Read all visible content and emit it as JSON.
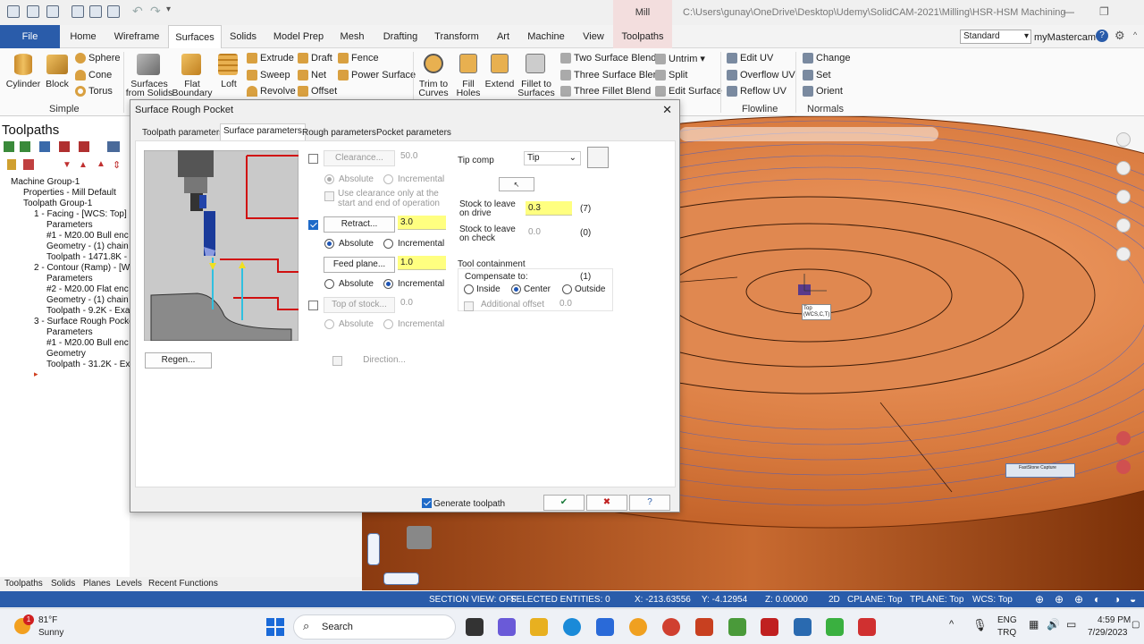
{
  "title_bar": {
    "context_tab": "Mill",
    "path": "C:\\Users\\gunay\\OneDrive\\Desktop\\Udemy\\SolidCAM-2021\\Milling\\HSR-HSM Machining User Gui..."
  },
  "tabs": [
    "File",
    "Home",
    "Wireframe",
    "Surfaces",
    "Solids",
    "Model Prep",
    "Mesh",
    "Drafting",
    "Transform",
    "Art",
    "Machine",
    "View",
    "Toolpaths"
  ],
  "workspace": {
    "standard": "Standard",
    "my": "myMastercam"
  },
  "ribbon": {
    "simple": {
      "label": "Simple",
      "cylinder": "Cylinder",
      "block": "Block",
      "sphere": "Sphere",
      "cone": "Cone",
      "torus": "Torus"
    },
    "create": {
      "surfaces_from_solids": [
        "Surfaces",
        "from Solids"
      ],
      "flat_boundary": [
        "Flat",
        "Boundary"
      ],
      "loft": "Loft",
      "extrude": "Extrude",
      "sweep": "Sweep",
      "revolve": "Revolve",
      "draft": "Draft",
      "net": "Net",
      "offset": "Offset",
      "fence": "Fence",
      "power_surface": "Power Surface"
    },
    "modify": {
      "trim_to_curves": [
        "Trim to",
        "Curves"
      ],
      "fill_holes": [
        "Fill",
        "Holes"
      ],
      "extend": "Extend",
      "fillet_to_surfaces": [
        "Fillet to",
        "Surfaces"
      ],
      "two_surface_blend": "Two Surface Blend",
      "three_surface_blend": "Three Surface Blend",
      "three_fillet_blend": "Three Fillet Blend",
      "untrim": "Untrim",
      "split": "Split",
      "edit_surface": "Edit Surface"
    },
    "flowline": {
      "label": "Flowline",
      "edit_uv": "Edit UV",
      "overflow_uv": "Overflow UV",
      "reflow_uv": "Reflow UV"
    },
    "normals": {
      "label": "Normals",
      "change": "Change",
      "set": "Set",
      "orient": "Orient"
    }
  },
  "toolpaths_panel": {
    "title": "Toolpaths",
    "tree": [
      "Machine Group-1",
      "Properties - Mill Default",
      "Toolpath Group-1",
      "1 - Facing - [WCS: Top]",
      "Parameters",
      "#1 - M20.00 Bull enc",
      "Geometry - (1) chain",
      "Toolpath - 1471.8K -",
      "2 - Contour (Ramp) - [W",
      "Parameters",
      "#2 - M20.00 Flat enc",
      "Geometry - (1) chain",
      "Toolpath - 9.2K - Exa",
      "3 - Surface Rough Pocke",
      "Parameters",
      "#1 - M20.00 Bull enc",
      "Geometry",
      "Toolpath - 31.2K - Ex"
    ],
    "bottom_tabs": [
      "Toolpaths",
      "Solids",
      "Planes",
      "Levels",
      "Recent Functions"
    ]
  },
  "dialog": {
    "title": "Surface Rough Pocket",
    "tabs": [
      "Toolpath parameters",
      "Surface parameters",
      "Rough parameters",
      "Pocket parameters"
    ],
    "clearance": {
      "label": "Clearance...",
      "value": "50.0",
      "absolute": "Absolute",
      "incremental": "Incremental",
      "use_clearance": [
        "Use clearance only at the",
        "start and end of operation"
      ]
    },
    "retract": {
      "label": "Retract...",
      "value": "3.0",
      "absolute": "Absolute",
      "incremental": "Incremental"
    },
    "feed_plane": {
      "label": "Feed plane...",
      "value": "1.0",
      "absolute": "Absolute",
      "incremental": "Incremental"
    },
    "top_of_stock": {
      "label": "Top of stock...",
      "value": "0.0",
      "absolute": "Absolute",
      "incremental": "Incremental"
    },
    "regen": "Regen...",
    "direction": "Direction...",
    "tip_comp": {
      "label": "Tip comp",
      "value": "Tip"
    },
    "stock_drive": {
      "label": [
        "Stock to leave",
        "on drive"
      ],
      "value": "0.3",
      "count": "(7)"
    },
    "stock_check": {
      "label": [
        "Stock to leave",
        "on check"
      ],
      "value": "0.0",
      "count": "(0)"
    },
    "containment": {
      "title": "Tool containment",
      "compensate": "Compensate to:",
      "count": "(1)",
      "inside": "Inside",
      "center": "Center",
      "outside": "Outside",
      "additional": "Additional offset",
      "additional_value": "0.0"
    },
    "generate": "Generate toolpath"
  },
  "viewport": {
    "view_label": [
      "Top",
      "(WCS,C,T)"
    ],
    "popup_title": "FastStone Capture"
  },
  "status": {
    "section": "SECTION VIEW: OFF",
    "selected": "SELECTED ENTITIES: 0",
    "x": "X:  -213.63556",
    "y": "Y:  -4.12954",
    "z": "Z:  0.00000",
    "mode": "2D",
    "cplane": "CPLANE: Top",
    "tplane": "TPLANE: Top",
    "wcs": "WCS: Top"
  },
  "taskbar": {
    "badge": "1",
    "temp": "81°F",
    "weather": "Sunny",
    "search": "Search",
    "lang": [
      "ENG",
      "TRQ"
    ],
    "time": "4:59 PM",
    "date": "7/29/2023"
  }
}
